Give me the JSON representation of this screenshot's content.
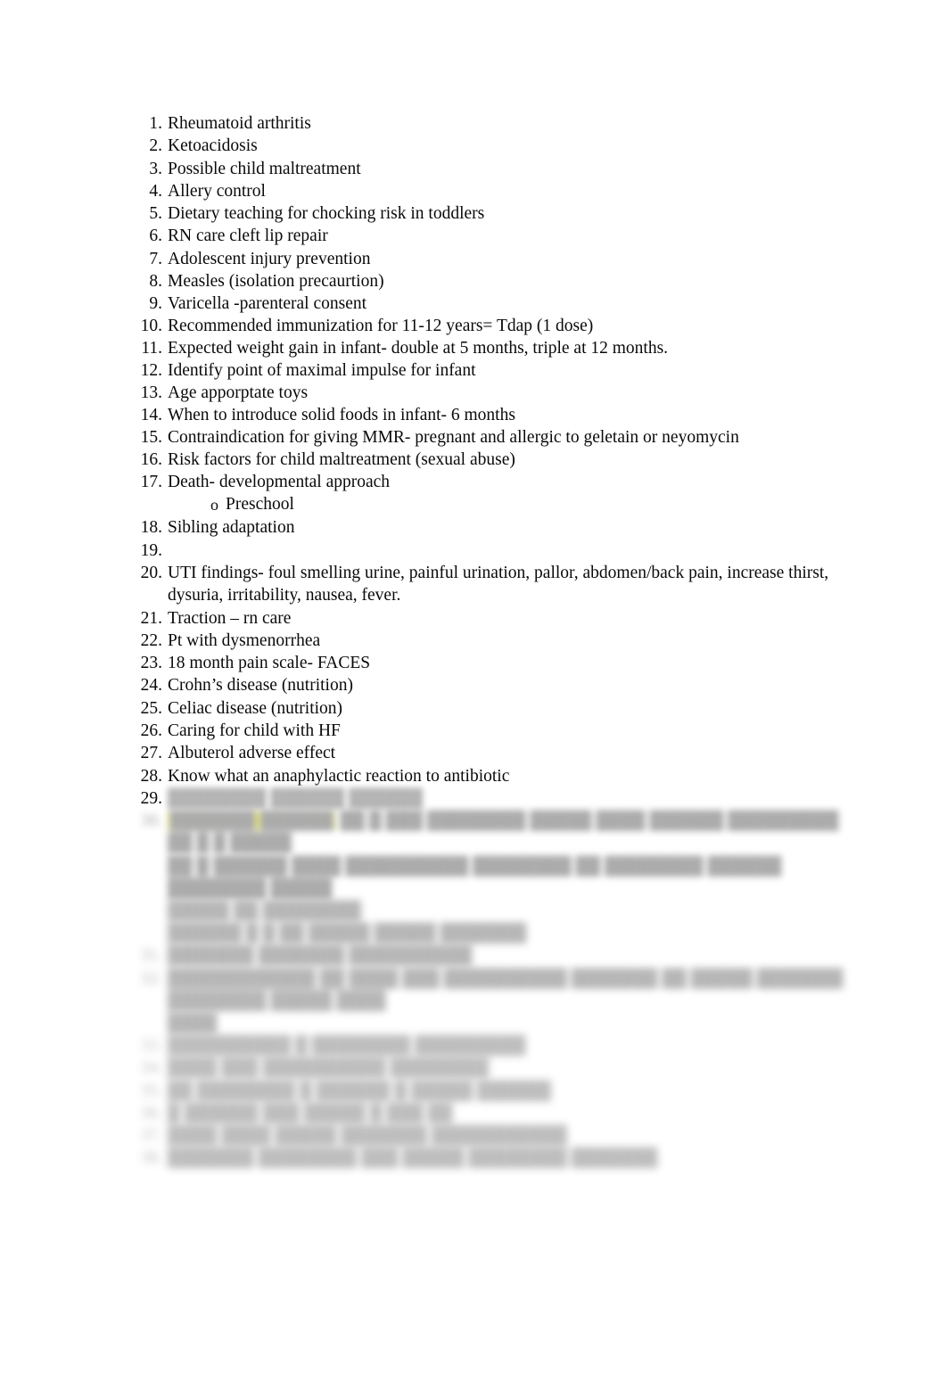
{
  "document": {
    "background_color": "#ffffff",
    "text_color": "#0a0a0a",
    "highlight_color": "#e8e818",
    "blurred_text_color": "#6f6f6f"
  },
  "list": {
    "items": [
      {
        "number": "1.",
        "text": "Rheumatoid arthritis"
      },
      {
        "number": "2.",
        "text": "Ketoacidosis"
      },
      {
        "number": "3.",
        "text": "Possible child maltreatment"
      },
      {
        "number": "4.",
        "text": "Allery control"
      },
      {
        "number": "5.",
        "text": "Dietary teaching for chocking risk in toddlers"
      },
      {
        "number": "6.",
        "text": "RN care cleft lip repair"
      },
      {
        "number": "7.",
        "text": "Adolescent injury prevention"
      },
      {
        "number": "8.",
        "text": "Measles (isolation precaurtion)"
      },
      {
        "number": "9.",
        "text": "Varicella -parenteral consent"
      },
      {
        "number": "10.",
        "text": "Recommended immunization for 11-12 years= Tdap (1 dose)"
      },
      {
        "number": "11.",
        "text": "Expected weight gain in infant- double at 5 months, triple at 12 months."
      },
      {
        "number": "12.",
        "text": "Identify point of maximal impulse for infant"
      },
      {
        "number": "13.",
        "text": "Age apporptate toys"
      },
      {
        "number": "14.",
        "text": "When to introduce solid foods in infant- 6 months"
      },
      {
        "number": "15.",
        "text": "Contraindication for giving MMR- pregnant and allergic to geletain or neyomycin"
      },
      {
        "number": "16.",
        "text": "Risk factors for child maltreatment (sexual abuse)"
      },
      {
        "number": "17.",
        "text": "Death- developmental approach"
      },
      {
        "number": "18.",
        "text": "Sibling adaptation"
      },
      {
        "number": "19.",
        "text": ""
      },
      {
        "number": "20.",
        "text": "UTI findings- foul smelling urine, painful urination, pallor, abdomen/back pain, increase thirst, dysuria, irritability, nausea, fever."
      },
      {
        "number": "21.",
        "text": "Traction – rn care"
      },
      {
        "number": "22.",
        "text": "Pt with dysmenorrhea"
      },
      {
        "number": "23.",
        "text": "18 month pain scale- FACES"
      },
      {
        "number": "24.",
        "text": "Crohn’s disease (nutrition)"
      },
      {
        "number": "25.",
        "text": "Celiac disease (nutrition)"
      },
      {
        "number": "26.",
        "text": "Caring for child with HF"
      },
      {
        "number": "27.",
        "text": "Albuterol adverse effect"
      },
      {
        "number": "28.",
        "text": "Know what an anaphylactic reaction to antibiotic"
      }
    ],
    "sub_bullet": {
      "after_item": "17.",
      "marker": "o",
      "text": "Preschool"
    }
  },
  "blurred_section": {
    "note": "Remaining list items are out of focus / illegible in the screenshot.",
    "partial_item": {
      "number": "29.",
      "text_illegible": "████████ ██████ ██████"
    },
    "lines": [
      {
        "number": "30.",
        "highlighted": "███████ ██████",
        "text_illegible": "██ █ ███ ████████ █████ ████ ██████ █████████ ██ █ █ █████"
      },
      {
        "number": "",
        "highlighted": "",
        "text_illegible": "██ █ ██████ ████ ██████████ ████████ ██ ████████ ██████ ████████ █████"
      },
      {
        "number": "",
        "highlighted": "",
        "text_illegible": "█████ ██ ████████"
      },
      {
        "number": "",
        "highlighted": "",
        "text_illegible": "██████ █ █ ██ █████ █████ ███████"
      },
      {
        "number": "31.",
        "highlighted": "",
        "text_illegible": "███████ ███████ ██████████"
      },
      {
        "number": "32.",
        "highlighted": "",
        "text_illegible": "████████████ ██ ████ ███ ██████████ ███████ ██ █████ ███████ ████████ █████ ████"
      },
      {
        "number": "",
        "highlighted": "",
        "text_illegible": "████"
      },
      {
        "number": "33.",
        "highlighted": "",
        "text_illegible": "██████████ █ ████████ █████████"
      },
      {
        "number": "34.",
        "highlighted": "",
        "text_illegible": "████ ███ ██████████ ████████"
      },
      {
        "number": "35.",
        "highlighted": "",
        "text_illegible": "██ ████████ █ ██████ █ █████ ██████"
      },
      {
        "number": "36.",
        "highlighted": "",
        "text_illegible": "█ ██████ ███ █████ █ ███ ██"
      },
      {
        "number": "37.",
        "highlighted": "",
        "text_illegible": "████ ████ █████ ███████ ███████████"
      },
      {
        "number": "38.",
        "highlighted": "",
        "text_illegible": "███████ ████████ ███ █████ ████████ ███████"
      }
    ]
  }
}
